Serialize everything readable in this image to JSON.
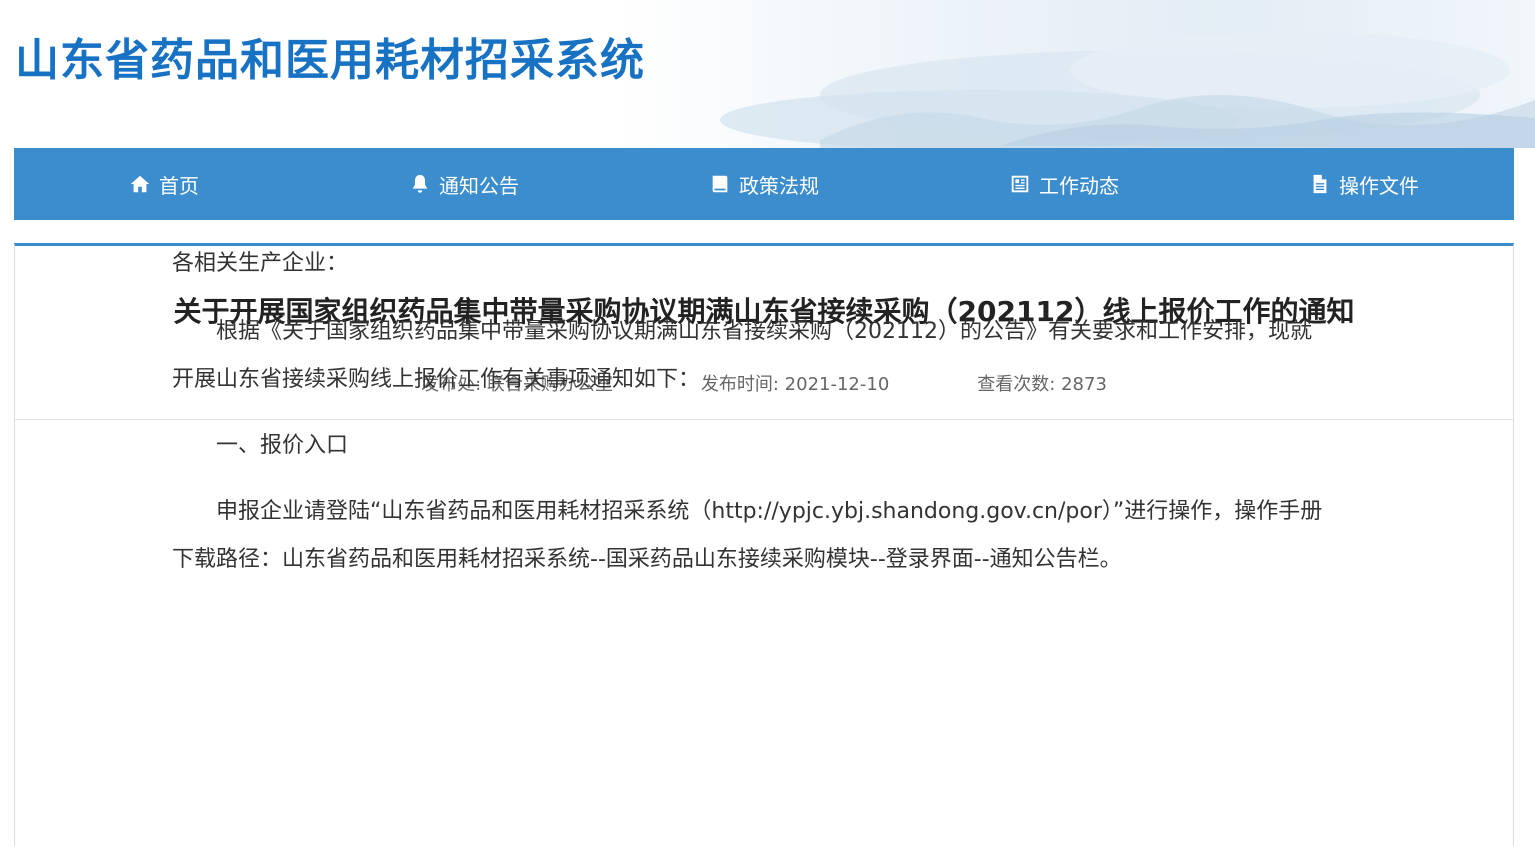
{
  "site": {
    "title": "山东省药品和医用耗材招采系统"
  },
  "nav": {
    "items": [
      {
        "label": "首页",
        "icon": "home-icon"
      },
      {
        "label": "通知公告",
        "icon": "bell-icon"
      },
      {
        "label": "政策法规",
        "icon": "book-icon"
      },
      {
        "label": "工作动态",
        "icon": "newspaper-icon"
      },
      {
        "label": "操作文件",
        "icon": "document-icon"
      }
    ]
  },
  "article": {
    "title": "关于开展国家组织药品集中带量采购协议期满山东省接续采购（202112）线上报价工作的通知",
    "publisher": "发布处: 联合采购办公室",
    "publish_time": "发布时间: 2021-12-10",
    "views": "查看次数: 2873",
    "salutation": "各相关生产企业：",
    "paragraph1": "根据《关于国家组织药品集中带量采购协议期满山东省接续采购（202112）的公告》有关要求和工作安排，现就开展山东省接续采购线上报价工作有关事项通知如下：",
    "section1_heading": "一、报价入口",
    "paragraph2": "申报企业请登陆“山东省药品和医用耗材招采系统（http://ypjc.ybj.shandong.gov.cn/por）”进行操作，操作手册下载路径：山东省药品和医用耗材招采系统--国采药品山东接续采购模块--登录界面--通知公告栏。"
  },
  "colors": {
    "brand_blue": "#1872c4",
    "nav_blue": "#3c8dce"
  }
}
